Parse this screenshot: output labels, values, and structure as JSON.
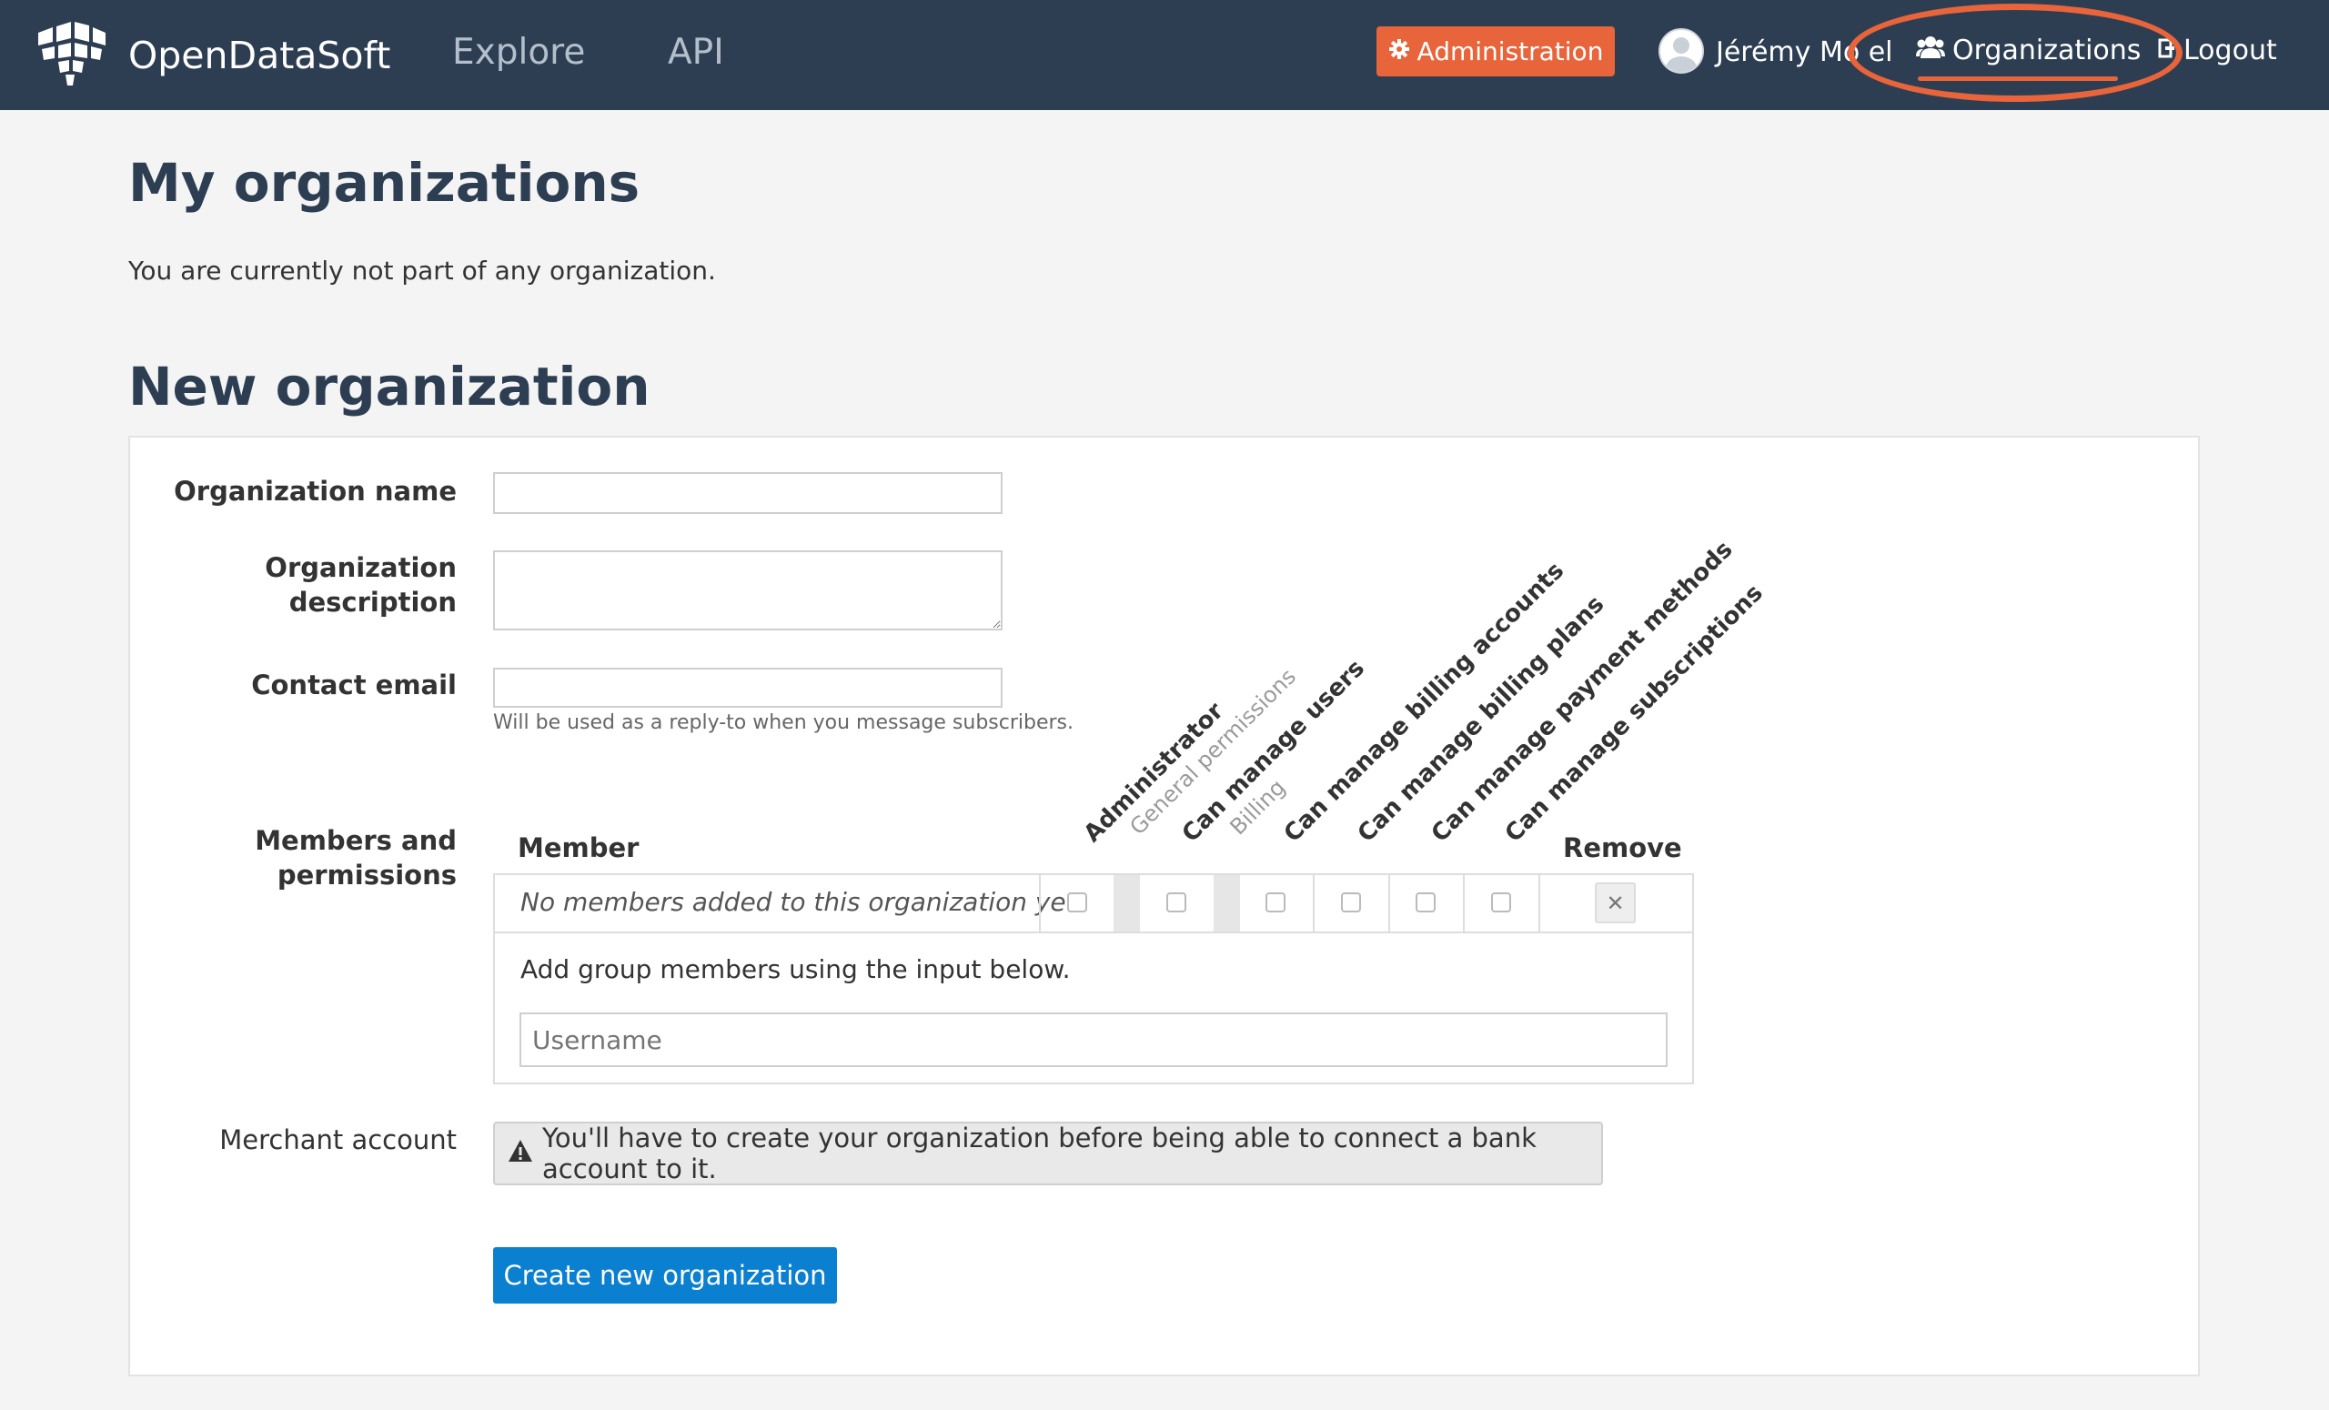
{
  "nav": {
    "brand": "OpenDataSoft",
    "links": [
      "Explore",
      "API"
    ],
    "admin_label": "Administration",
    "user_name": "Jérémy Mo el",
    "organizations_label": "Organizations",
    "logout_label": "Logout",
    "icons": {
      "admin": "gear-icon",
      "avatar": "user-avatar-icon",
      "organizations": "group-icon",
      "logout": "logout-icon"
    }
  },
  "page": {
    "my_orgs_title": "My organizations",
    "my_orgs_text": "You are currently not part of any organization.",
    "new_org_title": "New organization"
  },
  "form": {
    "org_name_label": "Organization name",
    "org_name_value": "",
    "org_desc_label_1": "Organization",
    "org_desc_label_2": "description",
    "org_desc_value": "",
    "contact_email_label": "Contact email",
    "contact_email_value": "",
    "contact_email_help": "Will be used as a reply-to when you message subscribers.",
    "members_label_1": "Members and",
    "members_label_2": "permissions",
    "member_col": "Member",
    "remove_col": "Remove",
    "permission_headers": [
      "Administrator",
      "General permissions",
      "Can manage users",
      "Billing",
      "Can manage billing accounts",
      "Can manage billing plans",
      "Can manage payment methods",
      "Can manage subscriptions"
    ],
    "no_members_text": "No members added to this organization yet.",
    "add_members_text": "Add group members using the input below.",
    "username_placeholder": "Username",
    "merchant_label": "Merchant account",
    "merchant_warning": "You'll have to create your organization before being able to connect a bank account to it.",
    "create_button": "Create new organization"
  },
  "colors": {
    "navbar": "#2d3e53",
    "accent_orange": "#e8643a",
    "primary_blue": "#0b7fd0",
    "heading": "#2d3e53"
  }
}
